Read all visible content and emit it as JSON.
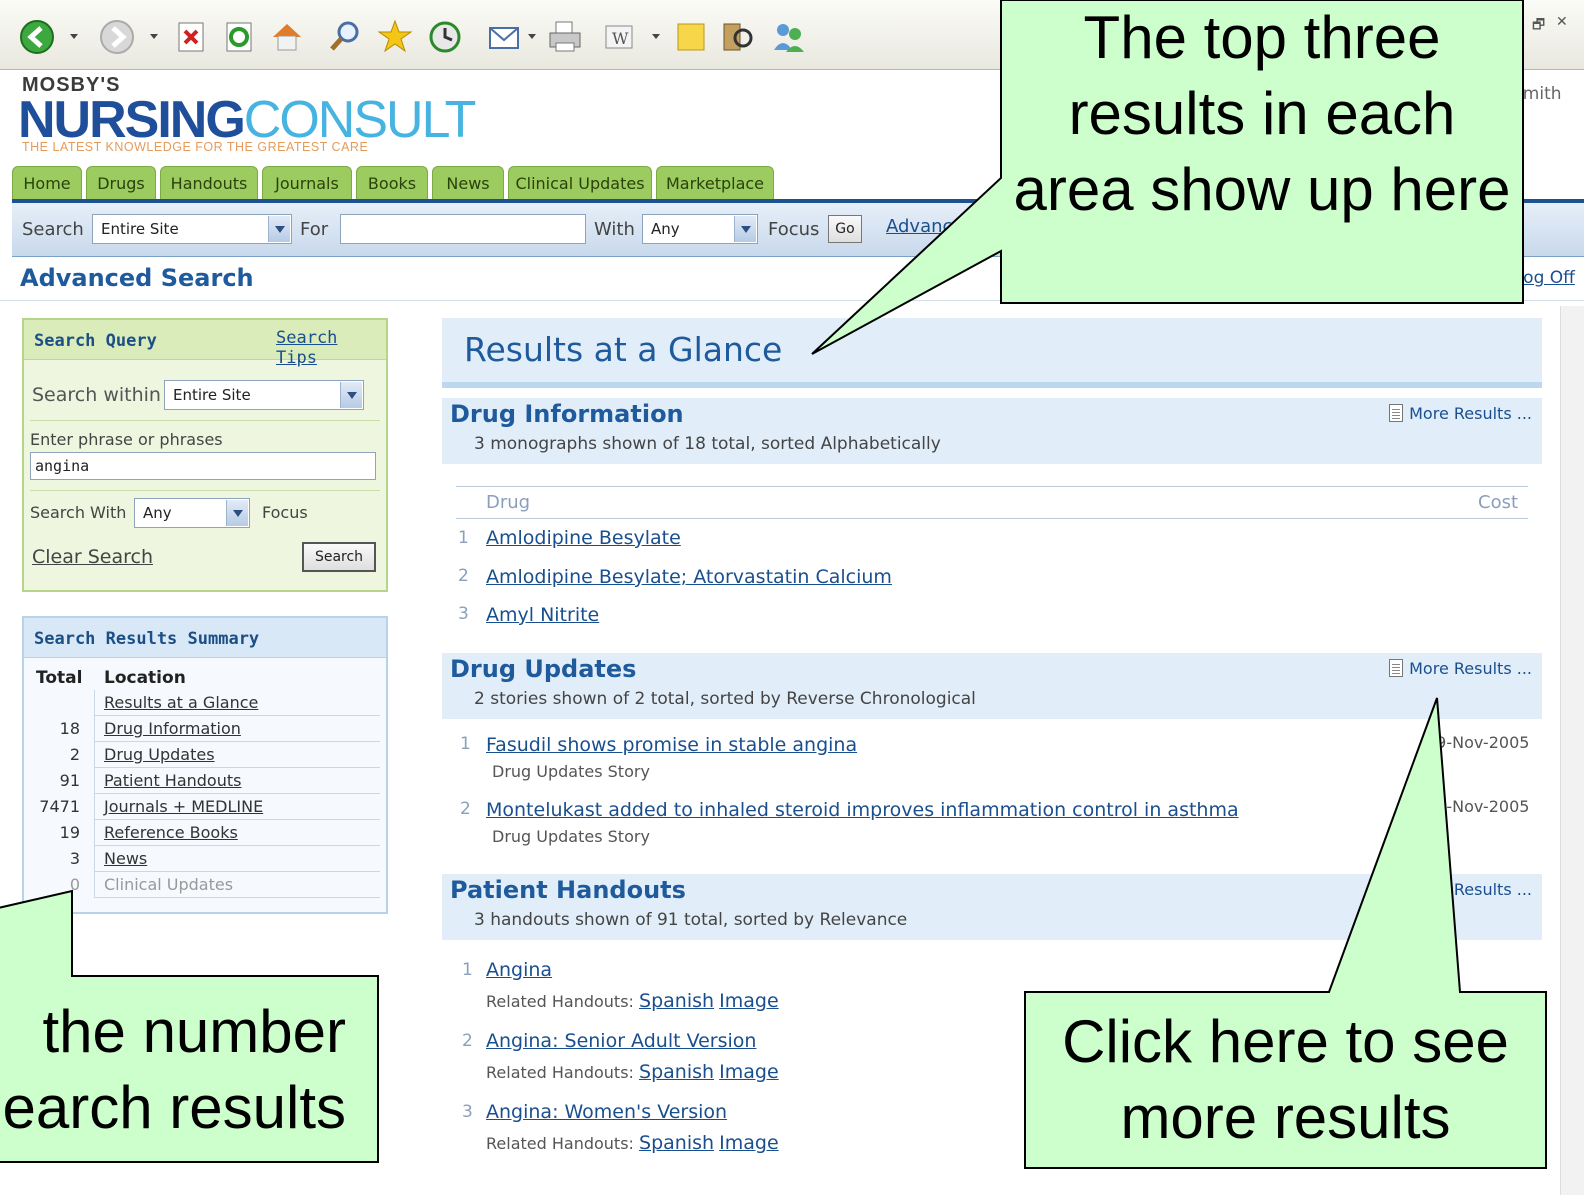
{
  "browser": {
    "toolbar_icons": [
      "back-icon",
      "forward-icon",
      "stop-icon",
      "refresh-icon",
      "home-icon",
      "search-icon",
      "favorites-icon",
      "history-icon",
      "mail-icon",
      "print-icon",
      "word-icon",
      "notes-icon",
      "research-icon",
      "messenger-icon"
    ],
    "window_controls": [
      "–",
      "🗗",
      "✕"
    ]
  },
  "header": {
    "brand_top": "MOSBY'S",
    "brand_main_a": "NURSING",
    "brand_main_b": "CONSULT",
    "tagline": "THE LATEST KNOWLEDGE FOR THE GREATEST CARE",
    "user": "Smith"
  },
  "nav": {
    "tabs": [
      "Home",
      "Drugs",
      "Handouts",
      "Journals",
      "Books",
      "News",
      "Clinical Updates",
      "Marketplace"
    ]
  },
  "searchbar": {
    "search_label": "Search",
    "scope_value": "Entire Site",
    "for_label": "For",
    "for_value": "",
    "with_label": "With",
    "with_value": "Any",
    "focus_label": "Focus",
    "go_label": "Go",
    "advanced_link": "Advanc"
  },
  "page": {
    "title": "Advanced Search",
    "logoff": "Log Off"
  },
  "search_query": {
    "title": "Search Query",
    "tips_link": "Search Tips",
    "within_label": "Search within",
    "within_value": "Entire Site",
    "phrase_label": "Enter phrase or phrases",
    "phrase_value": "angina",
    "with_label": "Search With",
    "with_value": "Any",
    "focus_label": "Focus",
    "clear_link": "Clear Search",
    "search_button": "Search"
  },
  "summary": {
    "title": "Search Results Summary",
    "col_total": "Total",
    "col_location": "Location",
    "rows": [
      {
        "total": "",
        "location": "Results at a Glance"
      },
      {
        "total": "18",
        "location": "Drug Information"
      },
      {
        "total": "2",
        "location": "Drug Updates"
      },
      {
        "total": "91",
        "location": "Patient Handouts"
      },
      {
        "total": "7471",
        "location": "Journals + MEDLINE"
      },
      {
        "total": "19",
        "location": "Reference Books"
      },
      {
        "total": "3",
        "location": "News"
      },
      {
        "total": "0",
        "location": "Clinical Updates"
      }
    ]
  },
  "results": {
    "title": "Results at a Glance",
    "more_label": "More Results ...",
    "drug_info": {
      "title": "Drug Information",
      "subtitle": "3 monographs shown of 18 total, sorted Alphabetically",
      "col_drug": "Drug",
      "col_cost": "Cost",
      "items": [
        {
          "n": "1",
          "name": "Amlodipine Besylate"
        },
        {
          "n": "2",
          "name": "Amlodipine Besylate; Atorvastatin Calcium"
        },
        {
          "n": "3",
          "name": "Amyl Nitrite"
        }
      ]
    },
    "drug_updates": {
      "title": "Drug Updates",
      "subtitle": "2 stories shown of 2 total, sorted by Reverse Chronological",
      "items": [
        {
          "n": "1",
          "title": "Fasudil shows promise in stable angina",
          "type": "Drug Updates Story",
          "date": "29-Nov-2005"
        },
        {
          "n": "2",
          "title": "Montelukast added to inhaled steroid improves inflammation control in asthma",
          "type": "Drug Updates Story",
          "date": "25-Nov-2005"
        }
      ]
    },
    "patient_handouts": {
      "title": "Patient Handouts",
      "subtitle": "3 handouts shown of 91 total, sorted by Relevance",
      "related_label": "Related Handouts:",
      "spanish": "Spanish",
      "image": "Image",
      "items": [
        {
          "n": "1",
          "title": "Angina"
        },
        {
          "n": "2",
          "title": "Angina: Senior Adult Version"
        },
        {
          "n": "3",
          "title": "Angina: Women's Version"
        }
      ]
    }
  },
  "callouts": {
    "top": "The top three results in each area show up here",
    "left_line1": "the number",
    "left_line2": "earch results",
    "right": "Click here to see more results"
  },
  "colors": {
    "callout_fill": "#ccffcc",
    "tab_green": "#9ccb5f",
    "brand_blue": "#1e5a9c"
  }
}
